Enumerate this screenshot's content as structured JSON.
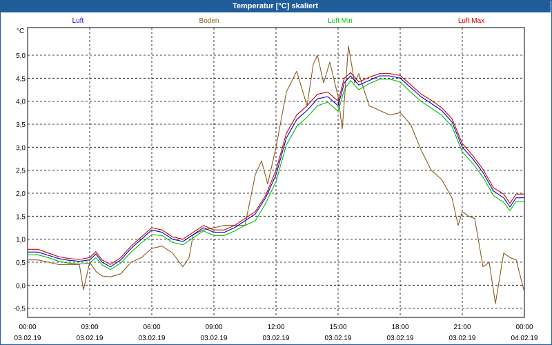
{
  "window": {
    "title": "Temperatur [°C] skaliert"
  },
  "chart_data": {
    "type": "line",
    "title": "Temperatur [°C] skaliert",
    "ylabel": "°C",
    "ylim": [
      -0.7,
      5.6
    ],
    "xlim": [
      0,
      24
    ],
    "yticks": [
      "5,0",
      "4,5",
      "4,0",
      "3,5",
      "3,0",
      "2,5",
      "2,0",
      "1,5",
      "1,0",
      "0,5",
      "0,0",
      "-0,5"
    ],
    "ytick_values": [
      5.0,
      4.5,
      4.0,
      3.5,
      3.0,
      2.5,
      2.0,
      1.5,
      1.0,
      0.5,
      0.0,
      -0.5
    ],
    "xticks": [
      {
        "time": "00:00",
        "date": "03.02.19"
      },
      {
        "time": "03:00",
        "date": "03.02.19"
      },
      {
        "time": "06:00",
        "date": "03.02.19"
      },
      {
        "time": "09:00",
        "date": "03.02.19"
      },
      {
        "time": "12:00",
        "date": "03.02.19"
      },
      {
        "time": "15:00",
        "date": "03.02.19"
      },
      {
        "time": "18:00",
        "date": "03.02.19"
      },
      {
        "time": "21:00",
        "date": "03.02.19"
      },
      {
        "time": "00:00",
        "date": "04.02.19"
      }
    ],
    "grid": true,
    "legend_position": "top",
    "series": [
      {
        "name": "Luft",
        "color": "#0000cc",
        "x": [
          0,
          0.5,
          1,
          1.5,
          2,
          2.5,
          3,
          3.3,
          3.6,
          4,
          4.5,
          5,
          5.5,
          6,
          6.5,
          7,
          7.5,
          8,
          8.5,
          9,
          9.5,
          10,
          10.5,
          11,
          11.5,
          12,
          12.5,
          13,
          13.5,
          14,
          14.5,
          15,
          15.3,
          15.6,
          16,
          16.5,
          17,
          17.5,
          18,
          18.5,
          19,
          19.5,
          20,
          20.5,
          21,
          21.5,
          22,
          22.5,
          23,
          23.3,
          23.6,
          24
        ],
        "values": [
          0.72,
          0.72,
          0.65,
          0.58,
          0.54,
          0.52,
          0.55,
          0.68,
          0.5,
          0.4,
          0.55,
          0.8,
          1.0,
          1.2,
          1.15,
          1.0,
          0.95,
          1.1,
          1.25,
          1.15,
          1.15,
          1.25,
          1.4,
          1.55,
          1.9,
          2.4,
          3.2,
          3.6,
          3.8,
          4.05,
          4.1,
          3.9,
          4.4,
          4.55,
          4.35,
          4.45,
          4.55,
          4.55,
          4.5,
          4.3,
          4.1,
          3.95,
          3.8,
          3.55,
          3.0,
          2.75,
          2.45,
          2.05,
          1.9,
          1.7,
          1.9,
          1.9
        ]
      },
      {
        "name": "Boden",
        "color": "#8b5a1a",
        "x": [
          0,
          0.5,
          1,
          1.5,
          2,
          2.5,
          2.7,
          3,
          3.3,
          3.6,
          4,
          4.5,
          5,
          5.5,
          6,
          6.5,
          7,
          7.5,
          7.8,
          8,
          8.5,
          9,
          9.5,
          10,
          10.5,
          11,
          11.3,
          11.6,
          12,
          12.5,
          13,
          13.5,
          13.8,
          14,
          14.3,
          14.6,
          15,
          15.2,
          15.5,
          15.8,
          16,
          16.5,
          17,
          17.5,
          18,
          18.5,
          19,
          19.5,
          20,
          20.5,
          20.8,
          21,
          21.3,
          21.6,
          22,
          22.3,
          22.6,
          23,
          23.3,
          23.6,
          24
        ],
        "values": [
          0.55,
          0.55,
          0.5,
          0.45,
          0.45,
          0.45,
          -0.1,
          0.5,
          0.3,
          0.2,
          0.18,
          0.25,
          0.5,
          0.6,
          0.8,
          0.85,
          0.7,
          0.4,
          0.6,
          1.1,
          1.2,
          1.25,
          1.3,
          1.3,
          1.3,
          2.4,
          2.7,
          2.2,
          3.0,
          4.2,
          4.65,
          3.9,
          4.8,
          5.0,
          4.4,
          4.85,
          4.1,
          3.4,
          5.2,
          4.4,
          4.6,
          3.9,
          3.8,
          3.7,
          3.75,
          3.5,
          2.95,
          2.5,
          2.3,
          1.9,
          1.3,
          1.6,
          1.5,
          1.45,
          0.4,
          0.5,
          -0.4,
          0.7,
          0.6,
          0.55,
          -0.15
        ]
      },
      {
        "name": "Luft Min",
        "color": "#00bb00",
        "x": [
          0,
          0.5,
          1,
          1.5,
          2,
          2.5,
          3,
          3.3,
          3.6,
          4,
          4.5,
          5,
          5.5,
          6,
          6.5,
          7,
          7.5,
          8,
          8.5,
          9,
          9.5,
          10,
          10.5,
          11,
          11.5,
          12,
          12.5,
          13,
          13.5,
          14,
          14.5,
          15,
          15.3,
          15.6,
          16,
          16.5,
          17,
          17.5,
          18,
          18.5,
          19,
          19.5,
          20,
          20.5,
          21,
          21.5,
          22,
          22.5,
          23,
          23.3,
          23.6,
          24
        ],
        "values": [
          0.66,
          0.66,
          0.6,
          0.52,
          0.48,
          0.46,
          0.48,
          0.6,
          0.44,
          0.34,
          0.48,
          0.72,
          0.92,
          1.1,
          1.08,
          0.93,
          0.88,
          1.03,
          1.18,
          1.08,
          1.08,
          1.18,
          1.3,
          1.4,
          1.78,
          2.25,
          3.05,
          3.45,
          3.65,
          3.9,
          3.98,
          3.78,
          4.25,
          4.45,
          4.25,
          4.38,
          4.48,
          4.48,
          4.42,
          4.2,
          4.0,
          3.85,
          3.7,
          3.45,
          2.9,
          2.65,
          2.35,
          1.95,
          1.8,
          1.62,
          1.82,
          1.82
        ]
      },
      {
        "name": "Luft Max",
        "color": "#cc0000",
        "x": [
          0,
          0.5,
          1,
          1.5,
          2,
          2.5,
          3,
          3.3,
          3.6,
          4,
          4.5,
          5,
          5.5,
          6,
          6.5,
          7,
          7.5,
          8,
          8.5,
          9,
          9.5,
          10,
          10.5,
          11,
          11.5,
          12,
          12.5,
          13,
          13.5,
          14,
          14.5,
          15,
          15.3,
          15.6,
          16,
          16.5,
          17,
          17.5,
          18,
          18.5,
          19,
          19.5,
          20,
          20.5,
          21,
          21.5,
          22,
          22.5,
          23,
          23.3,
          23.6,
          24
        ],
        "values": [
          0.78,
          0.78,
          0.7,
          0.62,
          0.58,
          0.56,
          0.6,
          0.73,
          0.55,
          0.45,
          0.6,
          0.85,
          1.05,
          1.25,
          1.2,
          1.05,
          1.0,
          1.15,
          1.3,
          1.2,
          1.2,
          1.3,
          1.45,
          1.6,
          1.95,
          2.5,
          3.3,
          3.7,
          3.9,
          4.15,
          4.2,
          4.0,
          4.5,
          4.62,
          4.42,
          4.52,
          4.6,
          4.6,
          4.56,
          4.36,
          4.16,
          4.02,
          3.86,
          3.62,
          3.08,
          2.82,
          2.52,
          2.12,
          1.98,
          1.78,
          1.98,
          1.98
        ]
      }
    ]
  }
}
